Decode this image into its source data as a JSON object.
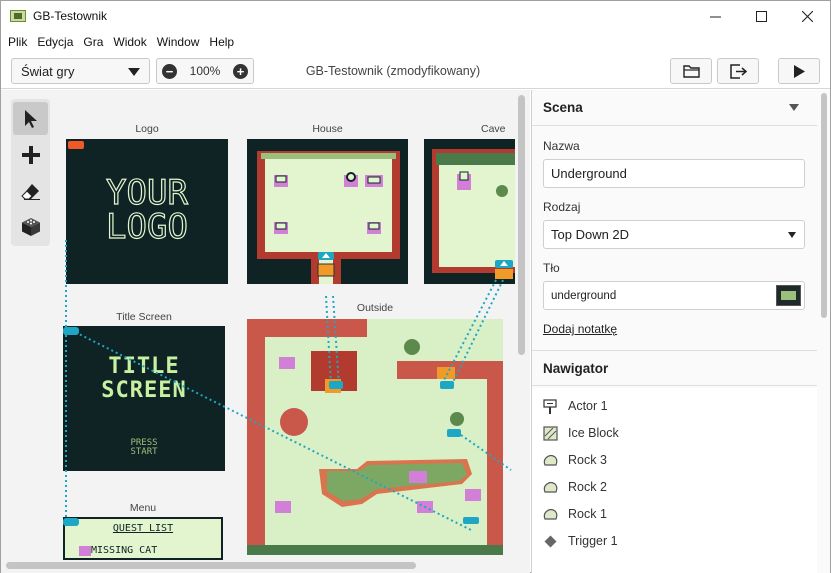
{
  "window": {
    "title": "GB-Testownik",
    "minimize": "—",
    "maximize": "☐",
    "close": "✕"
  },
  "menu": [
    "Plik",
    "Edycja",
    "Gra",
    "Widok",
    "Window",
    "Help"
  ],
  "toolbar": {
    "world_select": "Świat gry",
    "zoom_out": "−",
    "zoom_value": "100%",
    "zoom_in": "+",
    "project_title": "GB-Testownik (zmodyfikowany)"
  },
  "tools": [
    "select-arrow-icon",
    "add-plus-icon",
    "eraser-icon",
    "colors-cube-icon"
  ],
  "scenes": {
    "logo": {
      "label": "Logo",
      "line1": "YOUR",
      "line2": "LOGO"
    },
    "house": {
      "label": "House"
    },
    "cave": {
      "label": "Cave"
    },
    "title_screen": {
      "label": "Title Screen",
      "line1": "TITLE",
      "line2": "SCREEN",
      "press1": "PRESS",
      "press2": "START"
    },
    "outside": {
      "label": "Outside"
    },
    "menu": {
      "label": "Menu",
      "quest": "QUEST LIST",
      "item": "MISSING CAT"
    }
  },
  "panel": {
    "scene_header": "Scena",
    "name_label": "Nazwa",
    "name_value": "Underground",
    "type_label": "Rodzaj",
    "type_value": "Top Down 2D",
    "bg_label": "Tło",
    "bg_value": "underground",
    "add_note": "Dodaj notatkę",
    "navigator_header": "Nawigator",
    "navigator_items": [
      {
        "label": "Actor 1",
        "icon": "actor-signpost-icon"
      },
      {
        "label": "Ice Block",
        "icon": "ice-block-icon"
      },
      {
        "label": "Rock 3",
        "icon": "rock-icon"
      },
      {
        "label": "Rock 2",
        "icon": "rock-icon"
      },
      {
        "label": "Rock 1",
        "icon": "rock-icon"
      },
      {
        "label": "Trigger 1",
        "icon": "trigger-diamond-icon"
      }
    ]
  },
  "colors": {
    "gb_dark": "#0f2224",
    "gb_light": "#e3f5cf",
    "gb_mid": "#9bc07c",
    "wall_red": "#b23a2e",
    "connector": "#1ea7c5"
  }
}
